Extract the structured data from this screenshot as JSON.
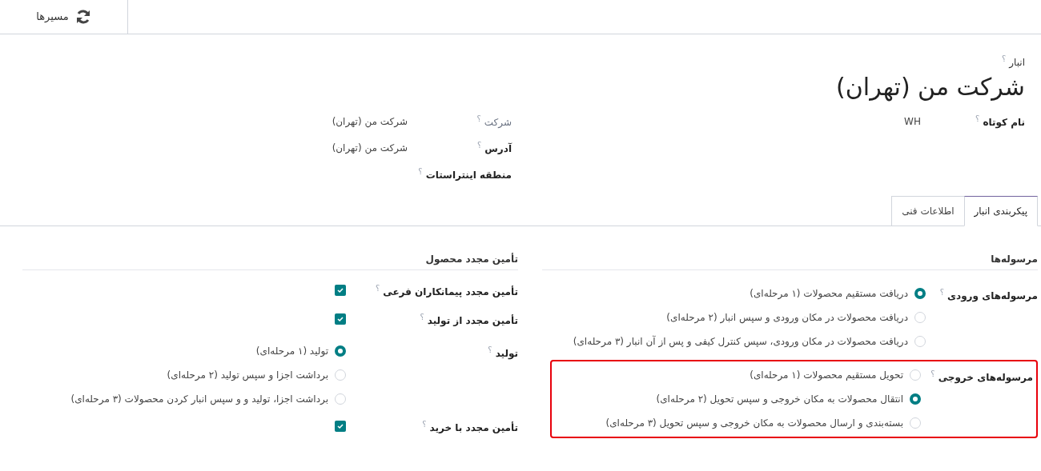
{
  "toolbar": {
    "routes_button": {
      "label": "مسیرها"
    }
  },
  "record": {
    "caption": "انبار",
    "caption_help": "؟",
    "title": "شرکت من (تهران)"
  },
  "fields_right": [
    {
      "label": "نام کوتاه",
      "help": "؟",
      "value": "WH",
      "muted": false
    }
  ],
  "fields_left": [
    {
      "label": "شرکت",
      "help": "؟",
      "value": "شرکت من (تهران)",
      "muted": true
    },
    {
      "label": "آدرس",
      "help": "؟",
      "value": "شرکت من (تهران)",
      "muted": false
    },
    {
      "label": "منطقه اینتراستات",
      "help": "؟",
      "muted": false
    }
  ],
  "tabs": [
    {
      "label": "پیکربندی انبار",
      "selected": true
    },
    {
      "label": "اطلاعات فنی",
      "selected": false
    }
  ],
  "sections": [
    {
      "title": "مرسوله‌ها",
      "groups": [
        {
          "kind": "radio",
          "label": "مرسوله‌های ورودی",
          "help": "؟",
          "highlighted": false,
          "options": [
            {
              "label": "دریافت مستقیم محصولات (۱ مرحله‌ای)",
              "selected": true
            },
            {
              "label": "دریافت محصولات در مکان ورودی و سپس انبار (۲ مرحله‌ای)",
              "selected": false
            },
            {
              "label": "دریافت محصولات در مکان ورودی، سپس کنترل کیفی و پس از آن انبار (۳ مرحله‌ای)",
              "selected": false
            }
          ]
        },
        {
          "kind": "radio",
          "label": "مرسوله‌های خروجی",
          "help": "؟",
          "highlighted": true,
          "options": [
            {
              "label": "تحویل مستقیم محصولات (۱ مرحله‌ای)",
              "selected": false
            },
            {
              "label": "انتقال محصولات به مکان خروجی و سپس تحویل (۲ مرحله‌ای)",
              "selected": true
            },
            {
              "label": "بسته‌بندی و ارسال محصولات به مکان خروجی و سپس تحویل (۳ مرحله‌ای)",
              "selected": false
            }
          ]
        }
      ]
    },
    {
      "title": "تأمین مجدد محصول",
      "groups": [
        {
          "kind": "checkbox",
          "label": "تأمین مجدد پیمانکاران فرعی",
          "help": "؟",
          "checked": true
        },
        {
          "kind": "checkbox",
          "label": "تأمین مجدد از تولید",
          "help": "؟",
          "checked": true
        },
        {
          "kind": "radio",
          "label": "تولید",
          "help": "؟",
          "highlighted": false,
          "options": [
            {
              "label": "تولید (۱ مرحله‌ای)",
              "selected": true
            },
            {
              "label": "برداشت اجزا و سپس تولید (۲ مرحله‌ای)",
              "selected": false
            },
            {
              "label": "برداشت اجزا، تولید و و سپس انبار کردن محصولات (۳ مرحله‌ای)",
              "selected": false
            }
          ]
        },
        {
          "kind": "checkbox",
          "label": "تأمین مجدد با خرید",
          "help": "؟",
          "checked": true
        }
      ]
    }
  ]
}
